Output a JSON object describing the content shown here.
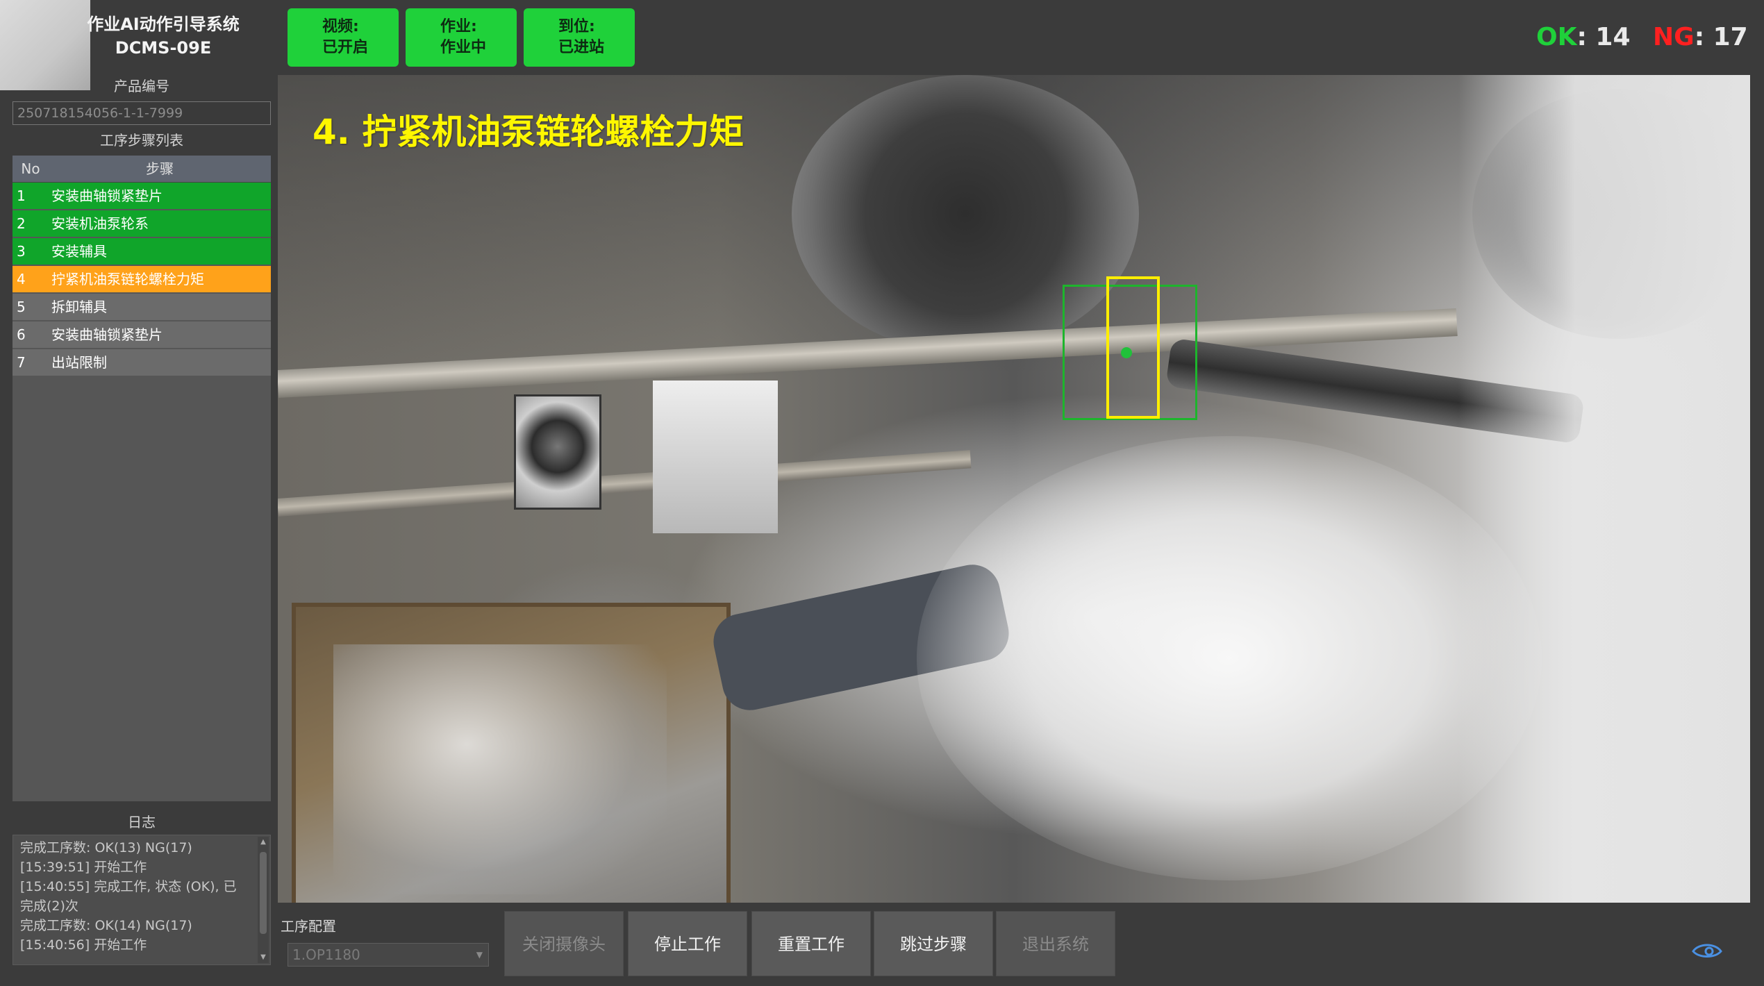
{
  "header": {
    "system_title_line1": "作业AI动作引导系统",
    "system_title_line2": "DCMS-09E",
    "status_buttons": [
      {
        "label": "视频:",
        "value": "已开启"
      },
      {
        "label": "作业:",
        "value": "作业中"
      },
      {
        "label": "到位:",
        "value": "已进站"
      }
    ],
    "ok_label": "OK",
    "ok_value": ": 14",
    "ng_label": "NG",
    "ng_value": ": 17"
  },
  "sidebar": {
    "product_label": "产品编号",
    "product_value": "250718154056-1-1-7999",
    "steps_label": "工序步骤列表",
    "col_no": "No",
    "col_step": "步骤",
    "steps": [
      {
        "no": "1",
        "name": "安装曲轴锁紧垫片",
        "state": "done"
      },
      {
        "no": "2",
        "name": "安装机油泵轮系",
        "state": "done"
      },
      {
        "no": "3",
        "name": "安装辅具",
        "state": "done"
      },
      {
        "no": "4",
        "name": "拧紧机油泵链轮螺栓力矩",
        "state": "active"
      },
      {
        "no": "5",
        "name": "拆卸辅具",
        "state": "pending"
      },
      {
        "no": "6",
        "name": "安装曲轴锁紧垫片",
        "state": "pending"
      },
      {
        "no": "7",
        "name": "出站限制",
        "state": "pending"
      }
    ]
  },
  "log": {
    "title": "日志",
    "lines": [
      "完成工序数: OK(13) NG(17)",
      "[15:39:51] 开始工作",
      "[15:40:55] 完成工作, 状态 (OK), 已",
      "完成(2)次",
      "完成工序数: OK(14) NG(17)",
      "[15:40:56] 开始工作"
    ]
  },
  "video": {
    "step_title": "4. 拧紧机油泵链轮螺栓力矩"
  },
  "footer": {
    "config_label": "工序配置",
    "config_value": "1.OP1180",
    "buttons": {
      "close_camera": "关闭摄像头",
      "stop_work": "停止工作",
      "reset_work": "重置工作",
      "skip_step": "跳过步骤",
      "exit_system": "退出系统"
    }
  },
  "colors": {
    "status_green": "#1fd13a",
    "step_done": "#10a52a",
    "step_active": "#ffa21a",
    "ng_red": "#ff2020",
    "overlay_yellow": "#fff700"
  },
  "icons": {
    "corner": "eye-icon"
  }
}
